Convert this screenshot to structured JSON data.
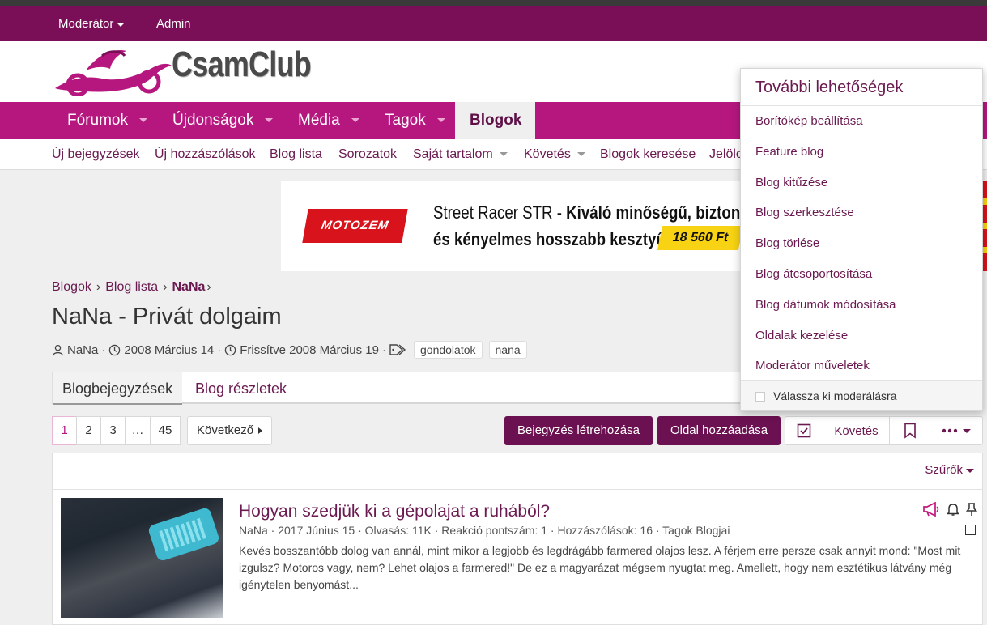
{
  "staff_bar": {
    "moderator": "Moderátor",
    "admin": "Admin"
  },
  "logo": {
    "text": "CsamClub"
  },
  "nav": {
    "tabs": [
      {
        "label": "Fórumok"
      },
      {
        "label": "Újdonságok"
      },
      {
        "label": "Média"
      },
      {
        "label": "Tagok"
      },
      {
        "label": "Blogok"
      }
    ]
  },
  "subnav": {
    "items": [
      {
        "label": "Új bejegyzések"
      },
      {
        "label": "Új hozzászólások"
      },
      {
        "label": "Blog lista"
      },
      {
        "label": "Sorozatok"
      },
      {
        "label": "Saját tartalom"
      },
      {
        "label": "Követés"
      },
      {
        "label": "Blogok keresése"
      },
      {
        "label": "Jelölc"
      }
    ]
  },
  "ad": {
    "brand": "MOTOZEM",
    "line1_prefix": "Street Racer STR - ",
    "line1_bold": "Kiváló minőségű, biztonságos",
    "line2": "és kényelmes hosszabb kesztyű!",
    "price": "18 560 Ft"
  },
  "breadcrumb": {
    "items": [
      "Blogok",
      "Blog lista",
      "NaNa"
    ]
  },
  "page": {
    "title": "NaNa - Privát dolgaim",
    "author": "NaNa",
    "created": "2008 Március 14",
    "updated": "Frissítve 2008 Március 19",
    "tags": [
      "gondolatok",
      "nana"
    ]
  },
  "tabs": {
    "posts": "Blogbejegyzések",
    "details": "Blog részletek"
  },
  "pager": {
    "pages": [
      "1",
      "2",
      "3",
      "…",
      "45"
    ],
    "next": "Következő"
  },
  "actions": {
    "create_post": "Bejegyzés létrehozása",
    "add_page": "Oldal hozzáadása",
    "follow": "Követés"
  },
  "list": {
    "filters": "Szűrők",
    "post": {
      "title": "Hogyan szedjük ki a gépolajat a ruhából?",
      "meta": "NaNa · 2017 Június 15 · Olvasás: 11K · Reakció pontszám: 1 · Hozzászólások: 16 · Tagok Blogjai",
      "body": "Kevés bosszantóbb dolog van annál, mint mikor a legjobb és legdrágább farmered olajos lesz. A férjem erre persze csak annyit mond: \"Most mit izgulsz? Motoros vagy, nem? Lehet olajos a farmered!\" De ez a magyarázat mégsem nyugtat meg. Amellett, hogy nem esztétikus látvány még igénytelen benyomást..."
    }
  },
  "menu": {
    "title": "További lehetőségek",
    "items": [
      "Borítókép beállítása",
      "Feature blog",
      "Blog kitűzése",
      "Blog szerkesztése",
      "Blog törlése",
      "Blog átcsoportosítása",
      "Blog dátumok módosítása",
      "Oldalak kezelése",
      "Moderátor műveletek"
    ],
    "footer": "Válassza ki moderálásra"
  },
  "colors": {
    "brand": "#b5177f",
    "staff_bar": "#7a0f57",
    "button": "#6b1050",
    "link": "#6a1a50"
  }
}
